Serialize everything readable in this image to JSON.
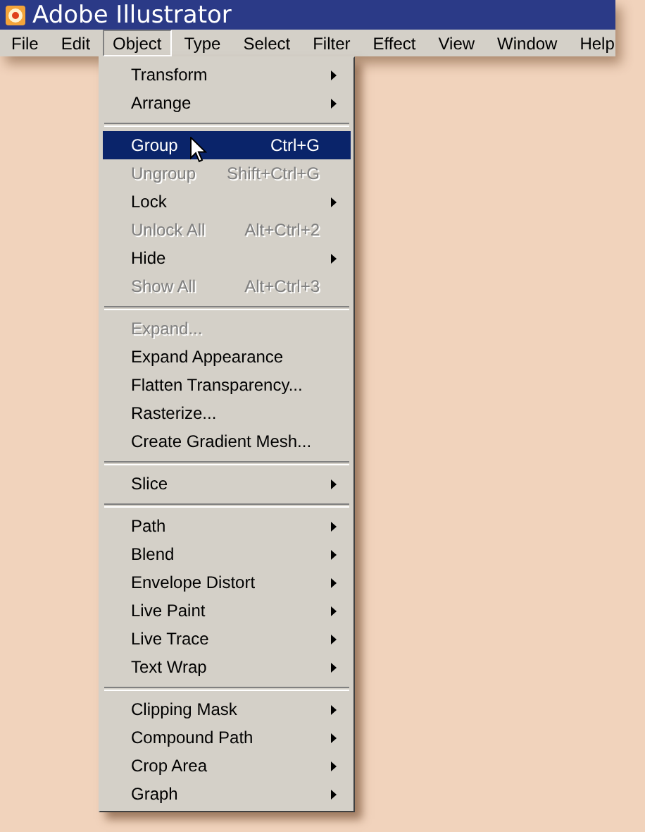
{
  "window": {
    "title": "Adobe Illustrator"
  },
  "menu_bar": [
    {
      "label": "File",
      "selected": false
    },
    {
      "label": "Edit",
      "selected": false
    },
    {
      "label": "Object",
      "selected": true
    },
    {
      "label": "Type",
      "selected": false
    },
    {
      "label": "Select",
      "selected": false
    },
    {
      "label": "Filter",
      "selected": false
    },
    {
      "label": "Effect",
      "selected": false
    },
    {
      "label": "View",
      "selected": false
    },
    {
      "label": "Window",
      "selected": false
    },
    {
      "label": "Help",
      "selected": false
    }
  ],
  "menu": {
    "groups": [
      [
        {
          "label": "Transform",
          "submenu": true,
          "disabled": false,
          "selected": false
        },
        {
          "label": "Arrange",
          "submenu": true,
          "disabled": false,
          "selected": false
        }
      ],
      [
        {
          "label": "Group",
          "shortcut": "Ctrl+G",
          "submenu": false,
          "disabled": false,
          "selected": true
        },
        {
          "label": "Ungroup",
          "shortcut": "Shift+Ctrl+G",
          "submenu": false,
          "disabled": true,
          "selected": false
        },
        {
          "label": "Lock",
          "submenu": true,
          "disabled": false,
          "selected": false
        },
        {
          "label": "Unlock All",
          "shortcut": "Alt+Ctrl+2",
          "submenu": false,
          "disabled": true,
          "selected": false
        },
        {
          "label": "Hide",
          "submenu": true,
          "disabled": false,
          "selected": false
        },
        {
          "label": "Show All",
          "shortcut": "Alt+Ctrl+3",
          "submenu": false,
          "disabled": true,
          "selected": false
        }
      ],
      [
        {
          "label": "Expand...",
          "submenu": false,
          "disabled": true,
          "selected": false
        },
        {
          "label": "Expand Appearance",
          "submenu": false,
          "disabled": false,
          "selected": false
        },
        {
          "label": "Flatten Transparency...",
          "submenu": false,
          "disabled": false,
          "selected": false
        },
        {
          "label": "Rasterize...",
          "submenu": false,
          "disabled": false,
          "selected": false
        },
        {
          "label": "Create Gradient Mesh...",
          "submenu": false,
          "disabled": false,
          "selected": false
        }
      ],
      [
        {
          "label": "Slice",
          "submenu": true,
          "disabled": false,
          "selected": false
        }
      ],
      [
        {
          "label": "Path",
          "submenu": true,
          "disabled": false,
          "selected": false
        },
        {
          "label": "Blend",
          "submenu": true,
          "disabled": false,
          "selected": false
        },
        {
          "label": "Envelope Distort",
          "submenu": true,
          "disabled": false,
          "selected": false
        },
        {
          "label": "Live Paint",
          "submenu": true,
          "disabled": false,
          "selected": false
        },
        {
          "label": "Live Trace",
          "submenu": true,
          "disabled": false,
          "selected": false
        },
        {
          "label": "Text Wrap",
          "submenu": true,
          "disabled": false,
          "selected": false
        }
      ],
      [
        {
          "label": "Clipping Mask",
          "submenu": true,
          "disabled": false,
          "selected": false
        },
        {
          "label": "Compound Path",
          "submenu": true,
          "disabled": false,
          "selected": false
        },
        {
          "label": "Crop Area",
          "submenu": true,
          "disabled": false,
          "selected": false
        },
        {
          "label": "Graph",
          "submenu": true,
          "disabled": false,
          "selected": false
        }
      ]
    ]
  }
}
